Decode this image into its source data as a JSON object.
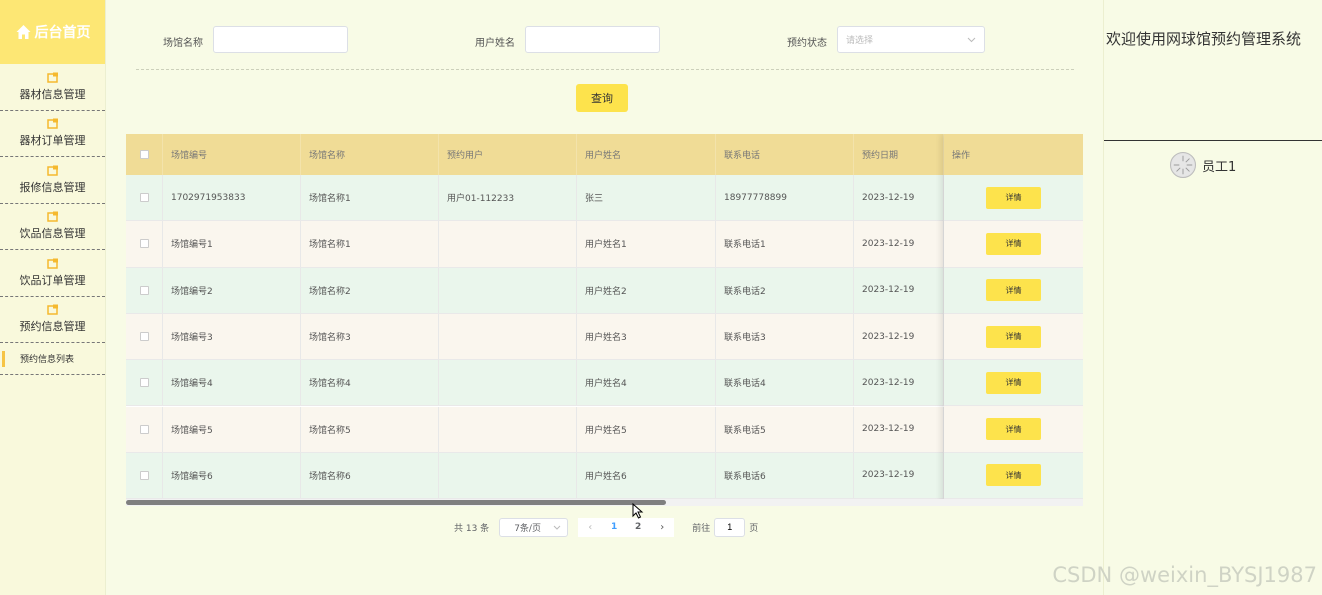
{
  "sidebar": {
    "brand": "后台首页",
    "items": [
      {
        "label": "器材信息管理"
      },
      {
        "label": "器材订单管理"
      },
      {
        "label": "报修信息管理"
      },
      {
        "label": "饮品信息管理"
      },
      {
        "label": "饮品订单管理"
      },
      {
        "label": "预约信息管理"
      }
    ],
    "subitem": "预约信息列表"
  },
  "search": {
    "venue_label": "场馆名称",
    "username_label": "用户姓名",
    "status_label": "预约状态",
    "status_placeholder": "请选择",
    "query_button": "查询"
  },
  "table": {
    "headers": [
      "场馆编号",
      "场馆名称",
      "预约用户",
      "用户姓名",
      "联系电话",
      "预约日期",
      "操作"
    ],
    "rows": [
      [
        "1702971953833",
        "场馆名称1",
        "用户01-112233",
        "张三",
        "18977778899",
        "2023-12-19"
      ],
      [
        "场馆编号1",
        "场馆名称1",
        "",
        "用户姓名1",
        "联系电话1",
        "2023-12-19"
      ],
      [
        "场馆编号2",
        "场馆名称2",
        "",
        "用户姓名2",
        "联系电话2",
        "2023-12-19"
      ],
      [
        "场馆编号3",
        "场馆名称3",
        "",
        "用户姓名3",
        "联系电话3",
        "2023-12-19"
      ],
      [
        "场馆编号4",
        "场馆名称4",
        "",
        "用户姓名4",
        "联系电话4",
        "2023-12-19"
      ],
      [
        "场馆编号5",
        "场馆名称5",
        "",
        "用户姓名5",
        "联系电话5",
        "2023-12-19"
      ],
      [
        "场馆编号6",
        "场馆名称6",
        "",
        "用户姓名6",
        "联系电话6",
        "2023-12-19"
      ]
    ],
    "detail_label": "详情",
    "row_colors": [
      "#eaf6ec",
      "#faf6ee"
    ]
  },
  "pagination": {
    "total": "共 13 条",
    "page_size": "7条/页",
    "pages": [
      "1",
      "2"
    ],
    "goto_prefix": "前往",
    "goto_value": "1",
    "goto_suffix": "页"
  },
  "header": {
    "welcome": "欢迎使用网球馆预约管理系统",
    "user": "员工1"
  },
  "watermark": "CSDN @weixin_BYSJ1987",
  "colors": {
    "accent": "#fde34c",
    "brand_bg": "#fde774",
    "table_head": "#f0dc96",
    "page_bg": "#f8fbe6"
  },
  "icons": {
    "brand": "home-icon",
    "menu": "folder-icon",
    "select": "chevron-down-icon"
  }
}
